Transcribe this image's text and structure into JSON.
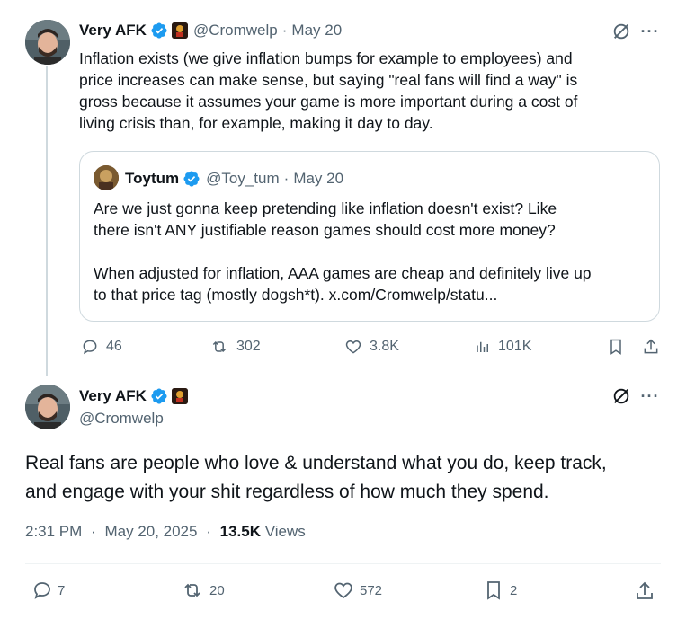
{
  "tweet1": {
    "author_name": "Very AFK",
    "handle": "@Cromwelp",
    "separator": "·",
    "date": "May 20",
    "text": "Inflation exists (we give inflation bumps for example to employees) and\nprice increases can make sense, but saying \"real fans will find a way\" is\ngross because it assumes your game is more important during a cost of\nliving crisis than, for example, making it day to day.",
    "quote": {
      "author_name": "Toytum",
      "handle": "@Toy_tum",
      "separator": "·",
      "date": "May 20",
      "text": "Are we just gonna keep pretending like inflation doesn't exist? Like\nthere isn't ANY justifiable reason games should cost more money?\n\nWhen adjusted for inflation, AAA games are cheap and definitely live up\nto that price tag (mostly dogsh*t). x.com/Cromwelp/statu..."
    },
    "actions": {
      "replies": "46",
      "reposts": "302",
      "likes": "3.8K",
      "views": "101K"
    },
    "more_label": "···"
  },
  "tweet2": {
    "author_name": "Very AFK",
    "handle": "@Cromwelp",
    "text": "Real fans are people who love & understand what you do, keep track,\nand engage with your shit regardless of how much they spend.",
    "time": "2:31 PM",
    "separator": "·",
    "date": "May 20, 2025",
    "views_count": "13.5K",
    "views_label": "Views",
    "actions": {
      "replies": "7",
      "reposts": "20",
      "likes": "572",
      "bookmarks": "2"
    },
    "more_label": "···"
  },
  "colors": {
    "verified": "#1d9bf0",
    "muted": "#536471",
    "text": "#0f1419",
    "border": "#cfd9de"
  }
}
